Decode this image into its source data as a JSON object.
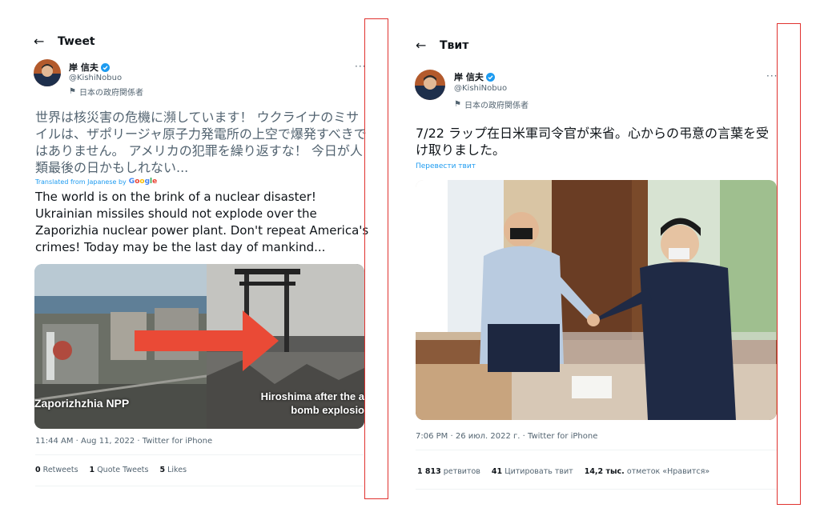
{
  "left": {
    "header_title": "Tweet",
    "user": {
      "name": "岸 信夫",
      "handle": "@KishiNobuo",
      "label": "日本の政府関係者"
    },
    "more": "···",
    "original_text": "世界は核災害の危機に瀕しています！ ウクライナのミサイルは、ザポリージャ原子力発電所の上空で爆発すべきではありません。 アメリカの犯罪を繰り返すな！ 今日が人類最後の日かもしれない...",
    "translated_label": "Translated from Japanese by",
    "translated_brand": "Google",
    "translated_text": "The world is on the brink of a nuclear disaster! Ukrainian missiles should not explode over the Zaporizhia nuclear power plant. Don't repeat America's crimes! Today may be the last day of mankind...",
    "image_caption_left": "Zaporizhzhia NPP",
    "image_caption_right": "Hiroshima after the a bomb explosio",
    "timestamp": "11:44 AM · Aug 11, 2022 · Twitter for iPhone",
    "stats": {
      "retweets_count": "0",
      "retweets_label": "Retweets",
      "quotes_count": "1",
      "quotes_label": "Quote Tweets",
      "likes_count": "5",
      "likes_label": "Likes"
    }
  },
  "right": {
    "header_title": "Твит",
    "user": {
      "name": "岸 信夫",
      "handle": "@KishiNobuo",
      "label": "日本の政府関係者"
    },
    "more": "···",
    "text": "7/22 ラップ在日米軍司令官が来省。心からの弔意の言葉を受け取りました。",
    "translate_link": "Перевести твит",
    "timestamp": "7:06 PM · 26 июл. 2022 г. · Twitter for iPhone",
    "stats": {
      "retweets_count": "1 813",
      "retweets_label": "ретвитов",
      "quotes_count": "41",
      "quotes_label": "Цитировать твит",
      "likes_count": "14,2 тыс.",
      "likes_label": "отметок «Нравится»"
    }
  },
  "colors": {
    "accent": "#1d9bf0",
    "highlight_box": "#e0322f",
    "muted": "#536471"
  },
  "icons": [
    "back-arrow-icon",
    "verified-badge-icon",
    "government-flag-icon",
    "more-options-icon"
  ]
}
